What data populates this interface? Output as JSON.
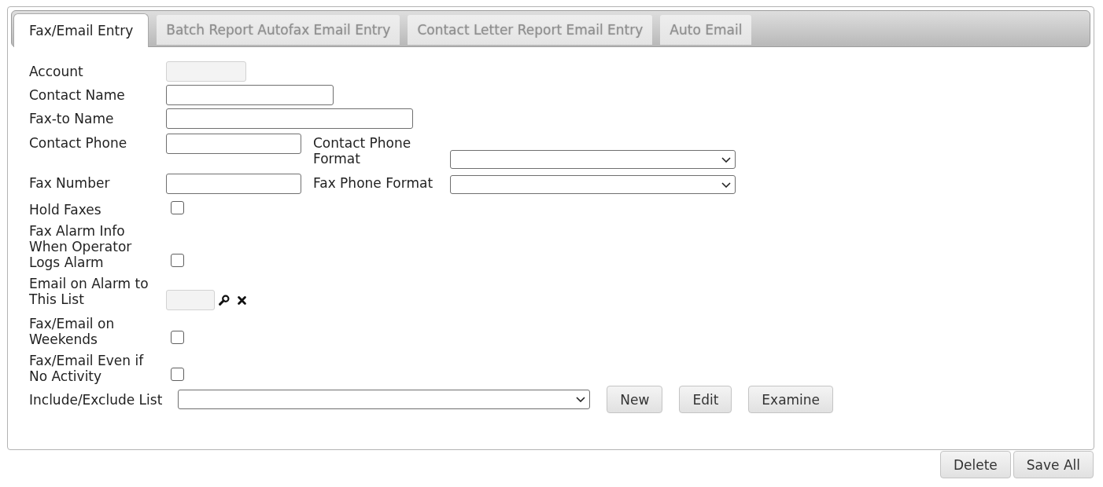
{
  "tabs": [
    {
      "label": "Fax/Email Entry",
      "selected": true
    },
    {
      "label": "Batch Report Autofax Email Entry",
      "selected": false
    },
    {
      "label": "Contact Letter Report Email Entry",
      "selected": false
    },
    {
      "label": "Auto Email",
      "selected": false
    }
  ],
  "form": {
    "rows": [
      {
        "kind": "text",
        "label": "Account",
        "disabled": true
      },
      {
        "kind": "text",
        "label": "Contact Name",
        "disabled": false
      },
      {
        "kind": "text",
        "label": "Fax-to Name",
        "disabled": false
      },
      {
        "kind": "phone",
        "label": "Contact Phone",
        "format_label": "Contact Phone Format"
      },
      {
        "kind": "phone",
        "label": "Fax Number",
        "format_label": "Fax Phone Format"
      },
      {
        "kind": "checkbox",
        "label": "Hold Faxes",
        "checked": false
      },
      {
        "kind": "checkbox",
        "label": "Fax Alarm Info When Operator Logs Alarm",
        "checked": false
      },
      {
        "kind": "lookup",
        "label": "Email on Alarm to This List",
        "disabled": true
      },
      {
        "kind": "checkbox",
        "label": "Fax/Email on Weekends",
        "checked": false
      },
      {
        "kind": "checkbox",
        "label": "Fax/Email Even if No Activity",
        "checked": false
      },
      {
        "kind": "list",
        "label": "Include/Exclude List",
        "buttons": [
          "New",
          "Edit",
          "Examine"
        ]
      }
    ]
  },
  "footer_buttons": [
    "Delete",
    "Save All"
  ]
}
